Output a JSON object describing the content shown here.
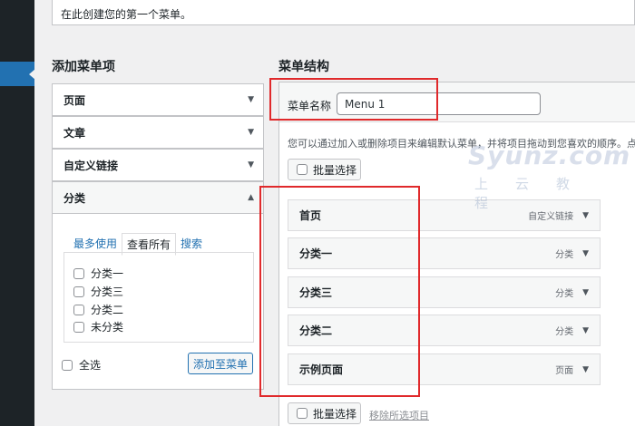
{
  "notice": "在此创建您的第一个菜单。",
  "left": {
    "title": "添加菜单项",
    "sections": [
      {
        "label": "页面"
      },
      {
        "label": "文章"
      },
      {
        "label": "自定义链接"
      },
      {
        "label": "分类"
      }
    ],
    "tabs": [
      "最多使用",
      "查看所有",
      "搜索"
    ],
    "categories": [
      "分类一",
      "分类三",
      "分类二",
      "未分类"
    ],
    "select_all": "全选",
    "add_button": "添加至菜单"
  },
  "right": {
    "title": "菜单结构",
    "name_label": "菜单名称",
    "name_value": "Menu 1",
    "description": "您可以通过加入或删除项目来编辑默认菜单，并将项目拖动到您喜欢的顺序。点击",
    "bulk_select": "批量选择",
    "remove_selected": "移除所选项目",
    "items": [
      {
        "title": "首页",
        "type": "自定义链接"
      },
      {
        "title": "分类一",
        "type": "分类"
      },
      {
        "title": "分类三",
        "type": "分类"
      },
      {
        "title": "分类二",
        "type": "分类"
      },
      {
        "title": "示例页面",
        "type": "页面"
      }
    ]
  },
  "watermark": {
    "text": "Syunz.com",
    "sub": "上云教程"
  },
  "colors": {
    "accent": "#2271b1",
    "highlight": "#e0292b",
    "sidebar": "#1d2327"
  }
}
